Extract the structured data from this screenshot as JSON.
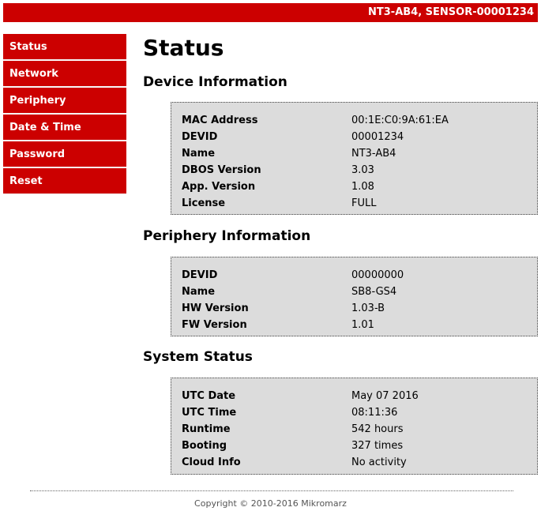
{
  "header": {
    "device_title": "NT3-AB4, SENSOR-00001234"
  },
  "sidebar": {
    "items": [
      {
        "label": "Status"
      },
      {
        "label": "Network"
      },
      {
        "label": "Periphery"
      },
      {
        "label": "Date & Time"
      },
      {
        "label": "Password"
      },
      {
        "label": "Reset"
      }
    ]
  },
  "main": {
    "title": "Status",
    "sections": [
      {
        "title": "Device Information",
        "rows": [
          {
            "key": "MAC Address",
            "value": "00:1E:C0:9A:61:EA"
          },
          {
            "key": "DEVID",
            "value": "00001234"
          },
          {
            "key": "Name",
            "value": "NT3-AB4"
          },
          {
            "key": "DBOS Version",
            "value": "3.03"
          },
          {
            "key": "App. Version",
            "value": "1.08"
          },
          {
            "key": "License",
            "value": "FULL"
          }
        ]
      },
      {
        "title": "Periphery Information",
        "rows": [
          {
            "key": "DEVID",
            "value": "00000000"
          },
          {
            "key": "Name",
            "value": "SB8-GS4"
          },
          {
            "key": "HW Version",
            "value": "1.03-B"
          },
          {
            "key": "FW Version",
            "value": "1.01"
          }
        ]
      },
      {
        "title": "System Status",
        "rows": [
          {
            "key": "UTC Date",
            "value": "May 07 2016"
          },
          {
            "key": "UTC Time",
            "value": "08:11:36"
          },
          {
            "key": "Runtime",
            "value": "542 hours"
          },
          {
            "key": "Booting",
            "value": "327 times"
          },
          {
            "key": "Cloud Info",
            "value": "No activity"
          }
        ]
      }
    ]
  },
  "footer": {
    "copyright": "Copyright © 2010-2016 Mikromarz"
  },
  "colors": {
    "accent": "#cc0000",
    "panel_bg": "#dcdcdc"
  }
}
